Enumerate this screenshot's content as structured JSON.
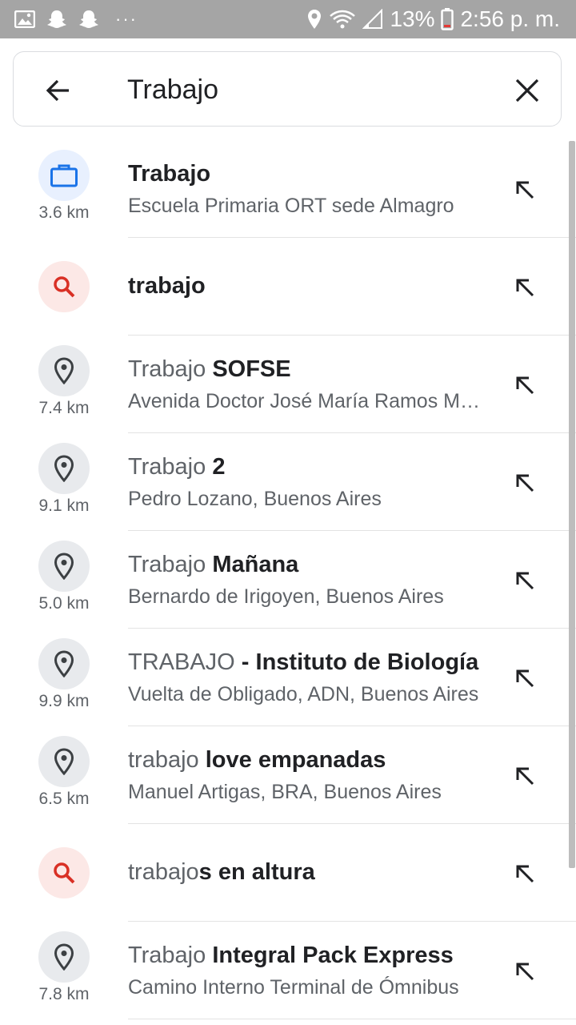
{
  "status_bar": {
    "battery": "13%",
    "time": "2:56 p. m.",
    "more": "···"
  },
  "search": {
    "value": "Trabajo",
    "back_icon": "arrow-back-icon",
    "clear_icon": "close-icon"
  },
  "suggestions": [
    {
      "type": "work",
      "icon": "briefcase-icon",
      "distance": "3.6 km",
      "title_match": "",
      "title_rest": "Trabajo",
      "subtitle": "Escuela Primaria ORT sede Almagro"
    },
    {
      "type": "query",
      "icon": "search-icon",
      "distance": "",
      "title_match": "",
      "title_rest": "trabajo",
      "subtitle": ""
    },
    {
      "type": "place",
      "icon": "location-pin-icon",
      "distance": "7.4 km",
      "title_match": "Trabajo",
      "title_rest": " SOFSE",
      "subtitle": "Avenida Doctor José María Ramos Mejía"
    },
    {
      "type": "place",
      "icon": "location-pin-icon",
      "distance": "9.1 km",
      "title_match": "Trabajo",
      "title_rest": " 2",
      "subtitle": "Pedro Lozano, Buenos Aires"
    },
    {
      "type": "place",
      "icon": "location-pin-icon",
      "distance": "5.0 km",
      "title_match": "Trabajo",
      "title_rest": " Mañana",
      "subtitle": "Bernardo de Irigoyen, Buenos Aires"
    },
    {
      "type": "place",
      "icon": "location-pin-icon",
      "distance": "9.9 km",
      "title_match": "TRABAJO",
      "title_rest": " - Instituto de Biología",
      "subtitle": "Vuelta de Obligado, ADN, Buenos Aires"
    },
    {
      "type": "place",
      "icon": "location-pin-icon",
      "distance": "6.5 km",
      "title_match": "trabajo",
      "title_rest": " love empanadas",
      "subtitle": "Manuel Artigas, BRA, Buenos Aires"
    },
    {
      "type": "query",
      "icon": "search-icon",
      "distance": "",
      "title_match": "trabajo",
      "title_rest": "s en altura",
      "subtitle": ""
    },
    {
      "type": "place",
      "icon": "location-pin-icon",
      "distance": "7.8 km",
      "title_match": "Trabajo",
      "title_rest": " Integral Pack Express",
      "subtitle": "Camino Interno Terminal de Ómnibus"
    }
  ],
  "colors": {
    "status_bar": "#a5a5a5",
    "work_icon": "#1a73e8",
    "search_icon": "#d93025",
    "pin_icon": "#3c4043"
  }
}
